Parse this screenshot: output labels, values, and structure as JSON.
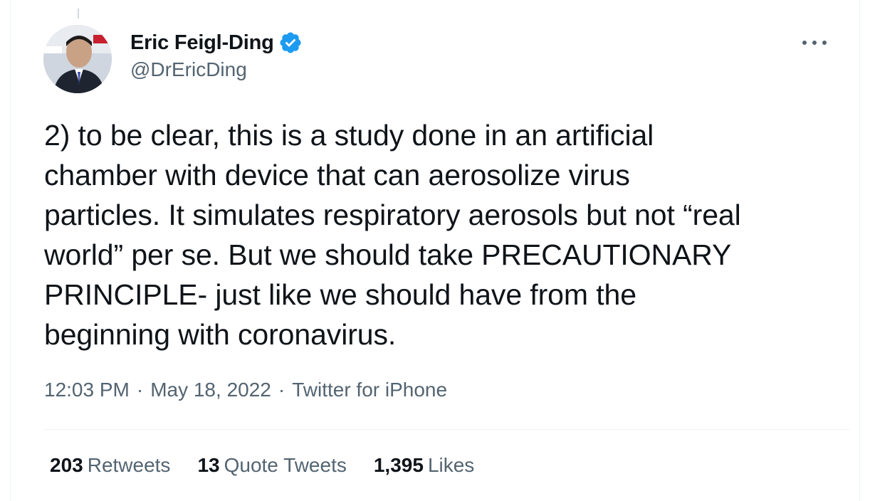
{
  "tweet": {
    "author": {
      "name": "Eric Feigl-Ding",
      "handle": "@DrEricDing",
      "verified": true,
      "avatar_icon": "profile-photo"
    },
    "text_lines": [
      "2) to be clear, this is a study done in an artificial",
      "chamber with device that can aerosolize virus",
      "particles. It simulates respiratory aerosols but not “real",
      "world” per se. But we should take PRECAUTIONARY",
      "PRINCIPLE- just like we should have from the",
      "beginning with coronavirus."
    ],
    "time": "12:03 PM",
    "date": "May 18, 2022",
    "source": "Twitter for iPhone",
    "separator": "·",
    "stats": {
      "retweets_count": "203",
      "retweets_label": "Retweets",
      "quotes_count": "13",
      "quotes_label": "Quote Tweets",
      "likes_count": "1,395",
      "likes_label": "Likes"
    }
  },
  "colors": {
    "text": "#0f1419",
    "secondary": "#536471",
    "verified": "#1d9bf0",
    "divider": "#eff3f4"
  }
}
